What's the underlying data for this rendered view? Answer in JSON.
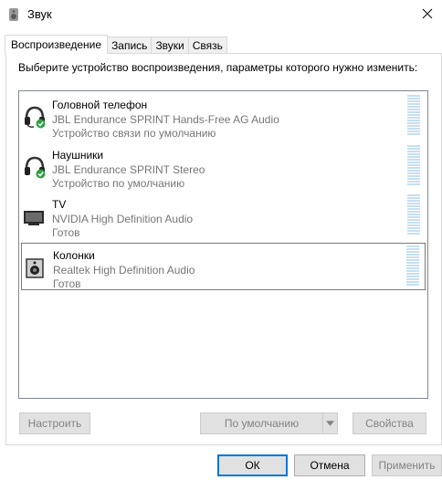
{
  "window": {
    "title": "Звук"
  },
  "tabs": [
    {
      "label": "Воспроизведение",
      "active": true
    },
    {
      "label": "Запись",
      "active": false
    },
    {
      "label": "Звуки",
      "active": false
    },
    {
      "label": "Связь",
      "active": false
    }
  ],
  "instruction": "Выберите устройство воспроизведения, параметры которого нужно изменить:",
  "devices": [
    {
      "name": "Головной телефон",
      "driver": "JBL Endurance SPRINT Hands-Free AG Audio",
      "status": "Устройство связи по умолчанию",
      "icon": "headset-icon",
      "badge": "green-check"
    },
    {
      "name": "Наушники",
      "driver": "JBL Endurance SPRINT Stereo",
      "status": "Устройство по умолчанию",
      "icon": "headphones-icon",
      "badge": "green-check"
    },
    {
      "name": "TV",
      "driver": "NVIDIA High Definition Audio",
      "status": "Готов",
      "icon": "tv-icon"
    },
    {
      "name": "Колонки",
      "driver": "Realtek High Definition Audio",
      "status": "Готов",
      "icon": "speaker-icon",
      "selected": true
    }
  ],
  "buttons": {
    "configure": "Настроить",
    "set_default": "По умолчанию",
    "properties": "Свойства",
    "ok": "ОК",
    "cancel": "Отмена",
    "apply": "Применить"
  },
  "colors": {
    "accent": "#0078d7",
    "check_green": "#2ea043",
    "level_bar": "#c6dff0"
  }
}
